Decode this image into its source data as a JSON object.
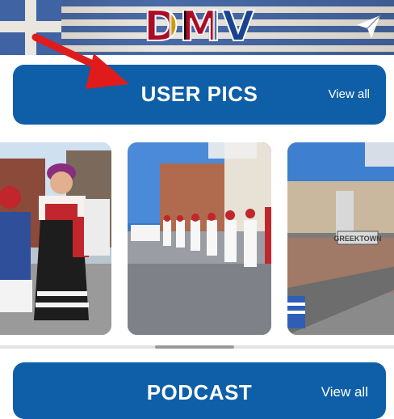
{
  "header": {
    "logo_text": "DMV",
    "share_icon": "send-icon"
  },
  "user_pics": {
    "title": "USER PICS",
    "view_all_label": "View all",
    "photos": [
      {
        "name": "girl-traditional-dress-photo"
      },
      {
        "name": "evzones-parade-street-photo"
      },
      {
        "name": "greektown-sign-photo",
        "sign_text": "GREEKTOWN"
      }
    ]
  },
  "podcast": {
    "title": "PODCAST",
    "view_all_label": "View all"
  },
  "colors": {
    "section_bar": "#0e5fa8",
    "flag_blue": "#3f63a3",
    "arrow_red": "#e01b1b"
  }
}
